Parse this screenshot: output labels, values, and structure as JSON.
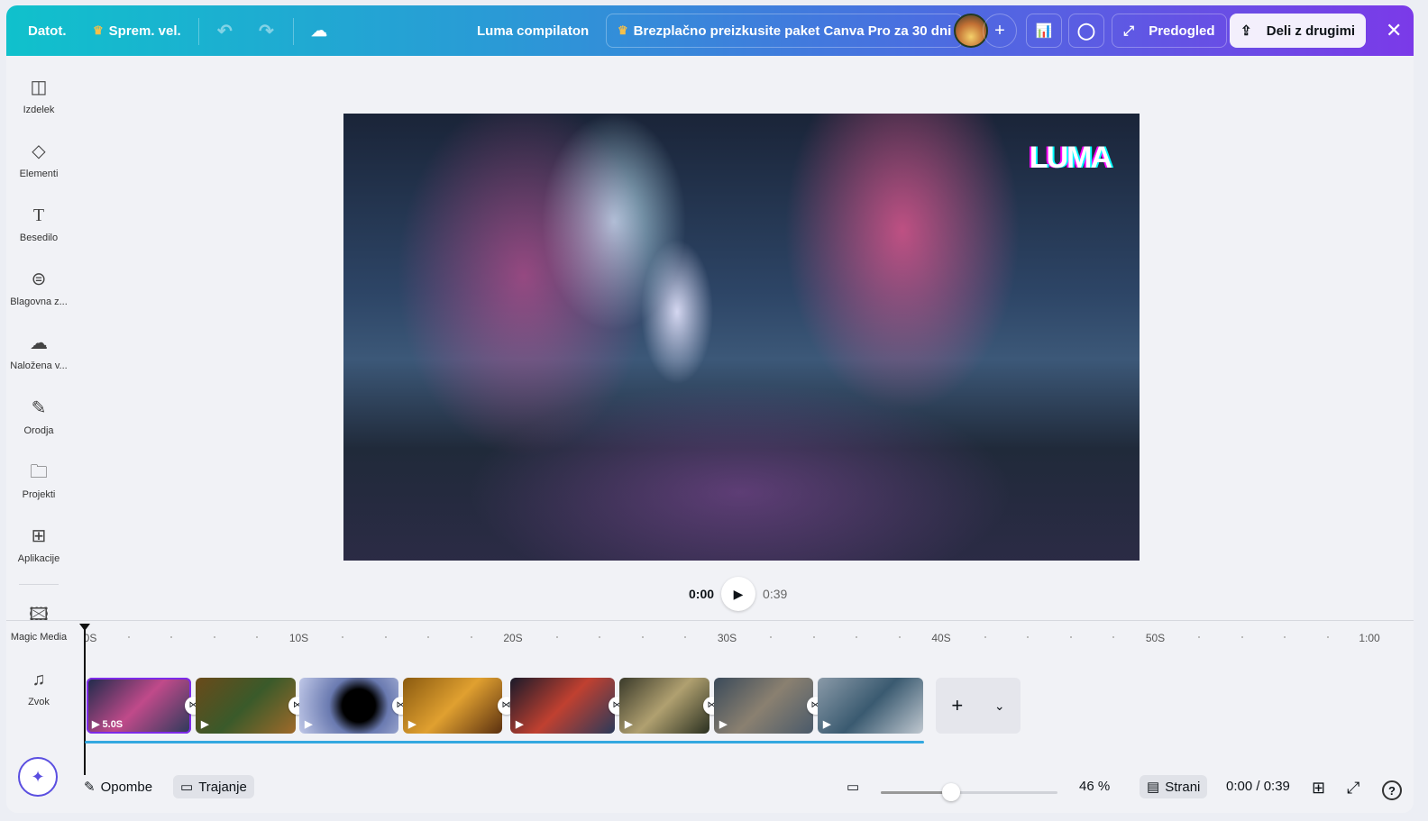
{
  "topbar": {
    "file": "Datot.",
    "resize": "Sprem. vel.",
    "title": "Luma compilaton",
    "promo": "Brezplačno preizkusite paket Canva Pro za 30 dni",
    "preview": "Predogled",
    "share": "Deli z drugimi"
  },
  "sidebar": {
    "items": [
      {
        "label": "Izdelek",
        "icon": "layout-icon"
      },
      {
        "label": "Elementi",
        "icon": "shapes-icon"
      },
      {
        "label": "Besedilo",
        "icon": "text-icon"
      },
      {
        "label": "Blagovna z...",
        "icon": "brand-icon"
      },
      {
        "label": "Naložena v...",
        "icon": "upload-icon"
      },
      {
        "label": "Orodja",
        "icon": "draw-icon"
      },
      {
        "label": "Projekti",
        "icon": "folder-icon"
      },
      {
        "label": "Aplikacije",
        "icon": "apps-icon"
      },
      {
        "label": "Magic Media",
        "icon": "magic-media-icon"
      },
      {
        "label": "Zvok",
        "icon": "music-icon"
      }
    ]
  },
  "canvas": {
    "logo_text": "LUMA"
  },
  "player": {
    "current": "0:00",
    "total": "0:39"
  },
  "timeline": {
    "ticks": [
      "0S",
      "10S",
      "20S",
      "30S",
      "40S",
      "50S",
      "1:00"
    ],
    "first_clip_duration": "5.0S",
    "clip_count": 8
  },
  "bottom": {
    "notes": "Opombe",
    "duration": "Trajanje",
    "zoom": "46 %",
    "zoom_value": 46,
    "pages": "Strani",
    "time": "0:00 / 0:39"
  }
}
